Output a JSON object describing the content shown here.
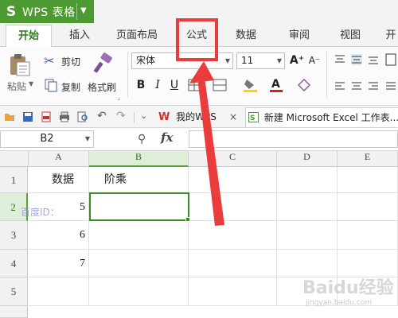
{
  "app": {
    "title": "WPS 表格",
    "accent": "#4d9a33"
  },
  "ribbon_tabs": [
    "开始",
    "插入",
    "页面布局",
    "公式",
    "数据",
    "审阅",
    "视图",
    "开"
  ],
  "ribbon": {
    "paste": "粘贴",
    "cut": "剪切",
    "copy": "复制",
    "format_painter": "格式刷",
    "font_name": "宋体",
    "font_size": "11"
  },
  "quick_access": {
    "doc_tabs": [
      {
        "label": "我的WPS",
        "close": "×"
      },
      {
        "label": "新建 Microsoft Excel 工作表..."
      }
    ]
  },
  "formula_bar": {
    "name_box": "B2",
    "fx_label": "fx",
    "content": ""
  },
  "sheet": {
    "columns": [
      "A",
      "B",
      "C",
      "D",
      "E"
    ],
    "rows": [
      "1",
      "2",
      "3",
      "4",
      "5"
    ],
    "cells": {
      "A1": "数据",
      "B1": "阶乘",
      "A2": "5",
      "A3": "6",
      "A4": "7"
    },
    "selected_cell": "B2"
  },
  "annotation": {
    "highlight_color": "#ea3c3c",
    "watermark": "百度ID：",
    "logo": "Baidu经验",
    "logo_sub": "jingyan.baidu.com"
  }
}
